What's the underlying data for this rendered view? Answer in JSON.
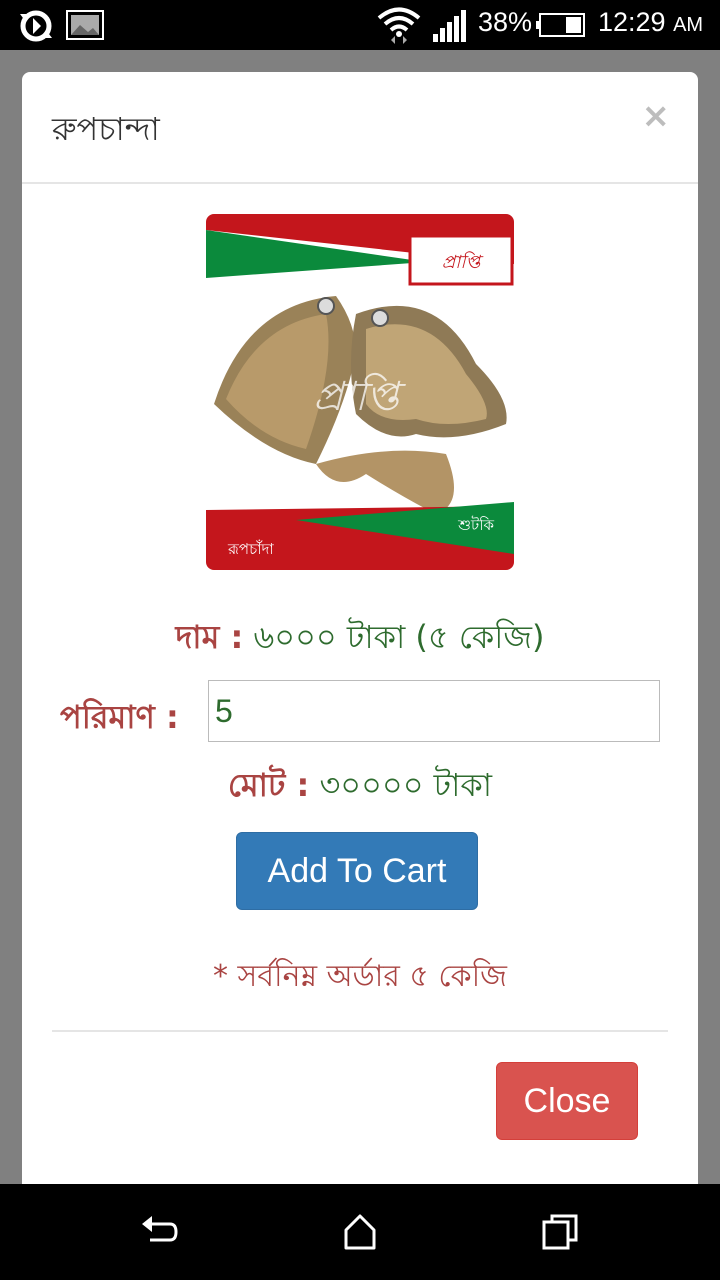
{
  "status_bar": {
    "battery_percent": "38%",
    "time": "12:29",
    "ampm": "AM",
    "icons": [
      "sync-icon",
      "image-icon",
      "wifi-icon",
      "signal-icon",
      "battery-icon"
    ]
  },
  "modal": {
    "title": "রুপচান্দা",
    "close_symbol": "×",
    "image_text": {
      "brand": "প্রাপ্তি",
      "category": "শুটকি",
      "product": "রূপচাঁদা"
    },
    "price": {
      "label": "দাম :",
      "value": "৬০০০ টাকা (৫ কেজি)"
    },
    "quantity": {
      "label": "পরিমাণ :",
      "value": "5"
    },
    "total": {
      "label": "মোট :",
      "value": "৩০০০০ টাকা"
    },
    "add_to_cart_label": "Add To Cart",
    "min_order_note": "* সর্বনিম্ন অর্ডার ৫ কেজি",
    "close_label": "Close"
  },
  "colors": {
    "label_red": "#a94442",
    "value_green": "#2e6b2e",
    "primary_blue": "#337ab7",
    "danger_red": "#d9534f"
  }
}
